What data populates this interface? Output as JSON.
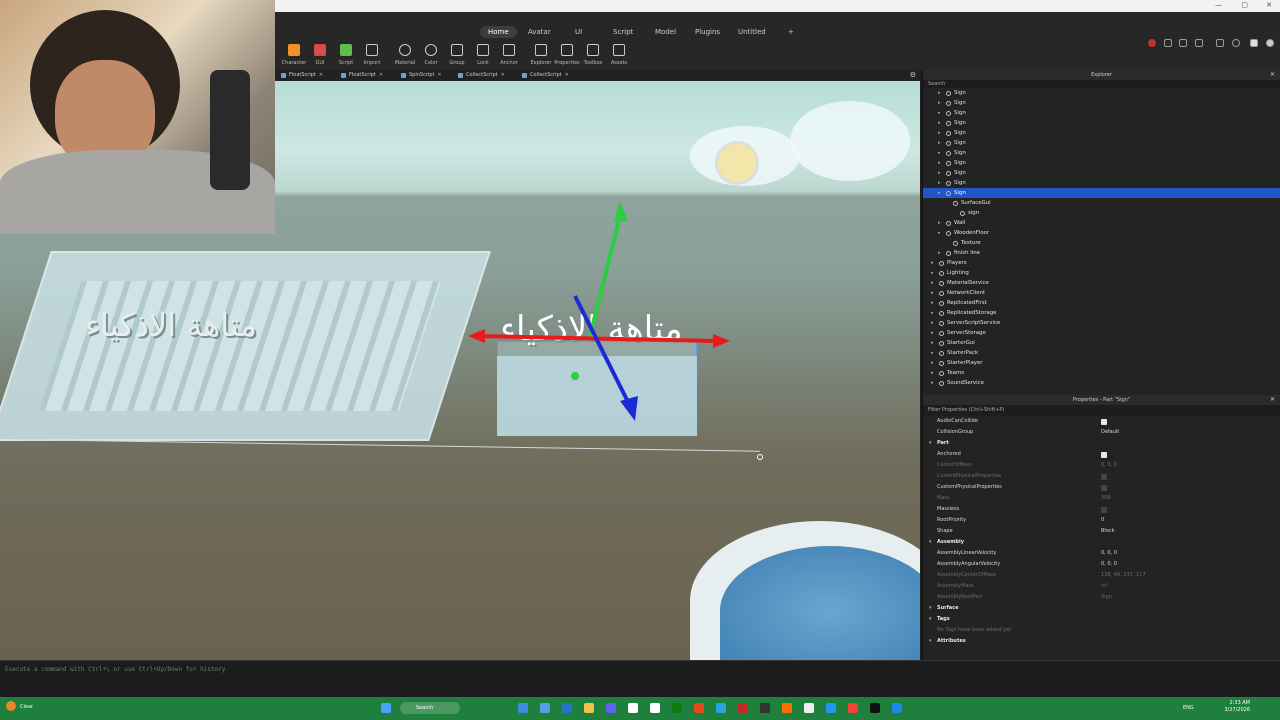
{
  "ribbon": {
    "menu_tabs": [
      "Home",
      "Avatar",
      "UI",
      "Script",
      "Model",
      "Plugins",
      "Untitled"
    ],
    "active_tab": "Home",
    "tools": [
      "Character",
      "GUI",
      "Script",
      "Import",
      "Material",
      "Color",
      "Group",
      "Lock",
      "Anchor",
      "Explorer",
      "Properties",
      "Toolbox",
      "Assets"
    ],
    "plus": "+"
  },
  "script_tabs": [
    "FloatScript",
    "FloatScript",
    "SpinScript",
    "CollectScript",
    "CollectScript"
  ],
  "viewport": {
    "sign_text_left": "متاهة الاذكياء",
    "sign_text_center": "متاهة الاذكياء"
  },
  "explorer": {
    "title": "Explorer",
    "search_placeholder": "Search",
    "items": [
      {
        "label": "Sign",
        "indent": 1
      },
      {
        "label": "Sign",
        "indent": 1
      },
      {
        "label": "Sign",
        "indent": 1
      },
      {
        "label": "Sign",
        "indent": 1
      },
      {
        "label": "Sign",
        "indent": 1
      },
      {
        "label": "Sign",
        "indent": 1
      },
      {
        "label": "Sign",
        "indent": 1
      },
      {
        "label": "Sign",
        "indent": 1
      },
      {
        "label": "Sign",
        "indent": 1
      },
      {
        "label": "Sign",
        "indent": 1
      },
      {
        "label": "Sign",
        "indent": 1,
        "selected": true
      },
      {
        "label": "SurfaceGui",
        "indent": 2
      },
      {
        "label": "sign",
        "indent": 3
      },
      {
        "label": "Wall",
        "indent": 1
      },
      {
        "label": "WoodenFloor",
        "indent": 1
      },
      {
        "label": "Texture",
        "indent": 2
      },
      {
        "label": "finish line",
        "indent": 1
      },
      {
        "label": "Players",
        "indent": 0
      },
      {
        "label": "Lighting",
        "indent": 0
      },
      {
        "label": "MaterialService",
        "indent": 0
      },
      {
        "label": "NetworkClient",
        "indent": 0
      },
      {
        "label": "ReplicatedFirst",
        "indent": 0
      },
      {
        "label": "ReplicatedStorage",
        "indent": 0
      },
      {
        "label": "ServerScriptService",
        "indent": 0
      },
      {
        "label": "ServerStorage",
        "indent": 0
      },
      {
        "label": "StarterGui",
        "indent": 0
      },
      {
        "label": "StarterPack",
        "indent": 0
      },
      {
        "label": "StarterPlayer",
        "indent": 0
      },
      {
        "label": "Teams",
        "indent": 0
      },
      {
        "label": "SoundService",
        "indent": 0
      }
    ]
  },
  "properties": {
    "title": "Properties - Part \"Sign\"",
    "filter_placeholder": "Filter Properties (Ctrl+Shift+P)",
    "rows": [
      {
        "name": "AudioCanCollide",
        "kind": "check",
        "value": true
      },
      {
        "name": "CollisionGroup",
        "kind": "text",
        "value": "Default"
      },
      {
        "name": "Part",
        "kind": "category"
      },
      {
        "name": "Anchored",
        "kind": "check",
        "value": true
      },
      {
        "name": "CenterOfMass",
        "kind": "dim",
        "value": "0, 0, 0"
      },
      {
        "name": "CurrentPhysicalProperties",
        "kind": "dimcheck"
      },
      {
        "name": "CustomPhysicalProperties",
        "kind": "checkoff"
      },
      {
        "name": "Mass",
        "kind": "dim",
        "value": "308"
      },
      {
        "name": "Massless",
        "kind": "checkoff"
      },
      {
        "name": "RootPriority",
        "kind": "text",
        "value": "0"
      },
      {
        "name": "Shape",
        "kind": "text",
        "value": "Block"
      },
      {
        "name": "Assembly",
        "kind": "category"
      },
      {
        "name": "AssemblyLinearVelocity",
        "kind": "text",
        "value": "0, 0, 0"
      },
      {
        "name": "AssemblyAngularVelocity",
        "kind": "text",
        "value": "0, 0, 0"
      },
      {
        "name": "AssemblyCenterOfMass",
        "kind": "dim",
        "value": "138, 49, 237, 117"
      },
      {
        "name": "AssemblyMass",
        "kind": "dim",
        "value": "inf"
      },
      {
        "name": "AssemblyRootPart",
        "kind": "dim",
        "value": "Sign"
      },
      {
        "name": "Surface",
        "kind": "category"
      },
      {
        "name": "Tags",
        "kind": "category"
      },
      {
        "name": "No Tags have been added yet",
        "kind": "note"
      },
      {
        "name": "Attributes",
        "kind": "category"
      }
    ]
  },
  "command_bar": {
    "placeholder": "Execute a command with Ctrl+\\ or use Ctrl+Up/Down for history"
  },
  "taskbar": {
    "search_label": "Search",
    "lang": "ENG",
    "time": "2:33 AM",
    "date": "3/27/2026",
    "weather": "Clear"
  }
}
